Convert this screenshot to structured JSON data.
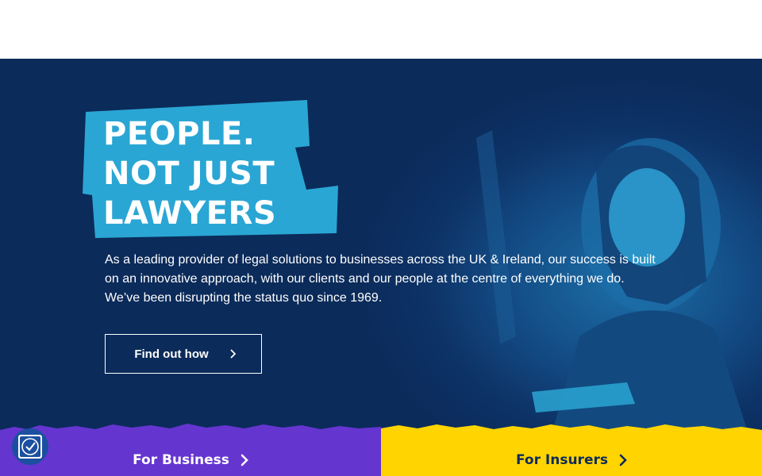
{
  "hero": {
    "headline": [
      "PEOPLE.",
      "NOT JUST",
      "LAWYERS"
    ],
    "intro": "As a leading provider of legal solutions to businesses across the UK & Ireland, our success is built on an innovative approach, with our clients and our people at the centre of everything we do. We’ve been disrupting the status quo since 1969.",
    "cta_label": "Find out how",
    "cta_icon": "chevron-right-icon"
  },
  "tiles": [
    {
      "label": "For Business",
      "icon": "chevron-right-icon",
      "color": "#6535d0"
    },
    {
      "label": "For Insurers",
      "icon": "chevron-right-icon",
      "color": "#ffd400"
    }
  ],
  "accessibility": {
    "icon": "accessibility-check-icon"
  },
  "colors": {
    "hero_bg": "#0b2b5a",
    "headline_tape": "#2aa6d4",
    "business": "#6535d0",
    "insurers": "#ffd400"
  }
}
